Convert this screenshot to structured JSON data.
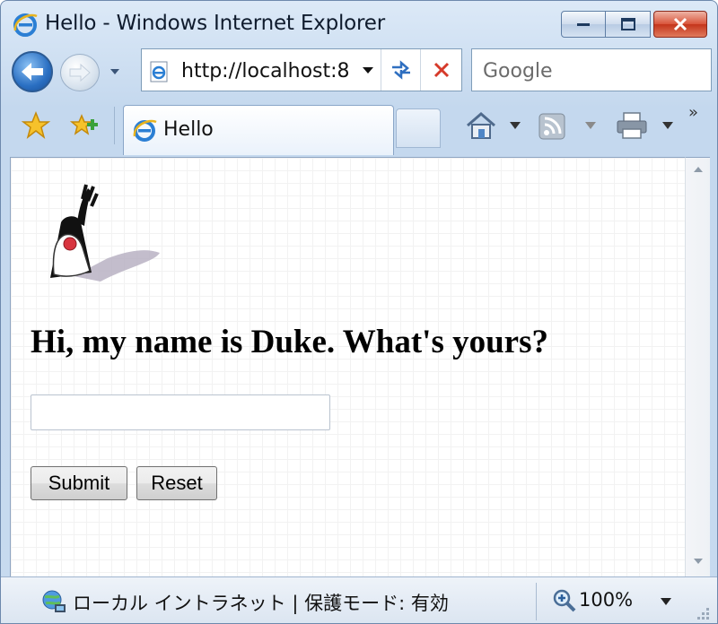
{
  "window": {
    "title": "Hello - Windows Internet Explorer"
  },
  "navigation": {
    "address": "http://localhost:8",
    "search_placeholder": "Google"
  },
  "tabs": [
    {
      "label": "Hello",
      "active": true
    }
  ],
  "page": {
    "heading": "Hi, my name is Duke. What's yours?",
    "name_input_value": "",
    "submit_label": "Submit",
    "reset_label": "Reset"
  },
  "status_bar": {
    "zone_text": "ローカル イントラネット | 保護モード: 有効",
    "zoom": "100%"
  },
  "icons": {
    "back": "back-arrow-icon",
    "forward": "forward-arrow-icon",
    "refresh": "refresh-icon",
    "stop": "stop-icon",
    "favorites": "favorites-star-icon",
    "add_favorite": "add-favorite-icon",
    "home": "home-icon",
    "feeds": "rss-feed-icon",
    "print": "printer-icon",
    "zone": "intranet-globe-icon",
    "zoom": "magnifier-icon"
  }
}
